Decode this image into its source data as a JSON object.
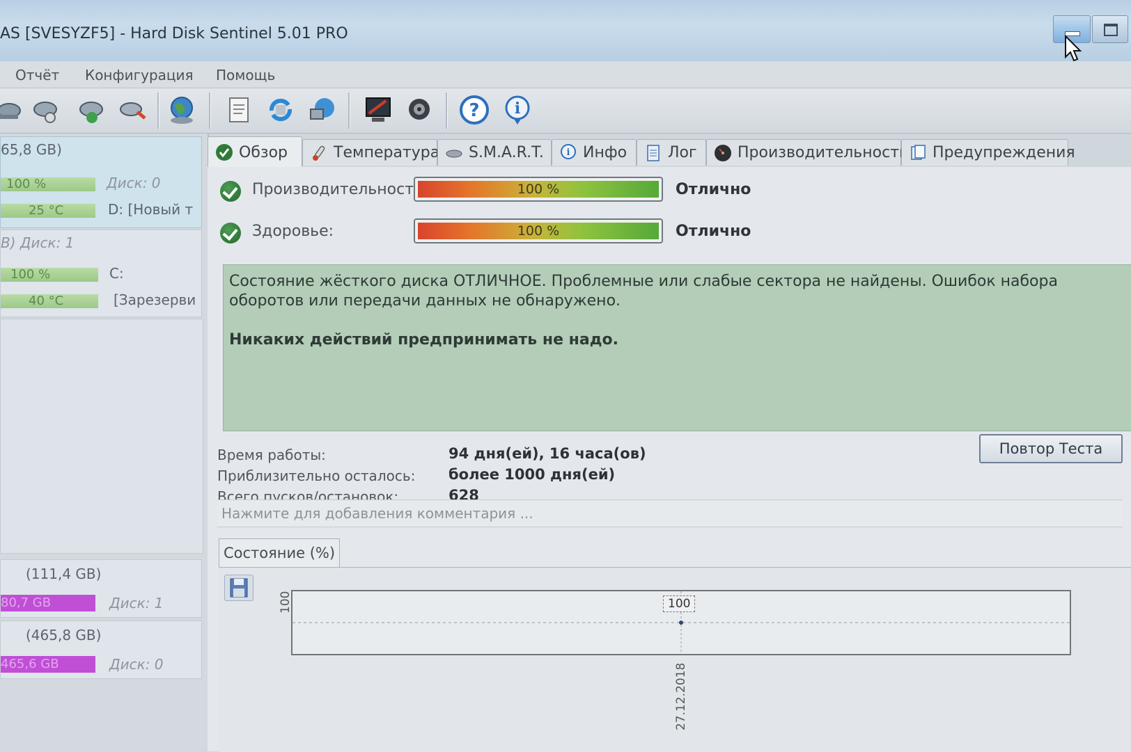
{
  "window": {
    "title": "AS [SVESYZF5]  -  Hard Disk Sentinel 5.01 PRO"
  },
  "menu": {
    "items": [
      "Отчёт",
      "Конфигурация",
      "Помощь"
    ]
  },
  "toolbar": {
    "icons": [
      "disk-icon",
      "disk-check-icon",
      "disk-add-icon",
      "disk-tools-icon",
      "globe-icon",
      "report-icon",
      "refresh-icon",
      "network-icon",
      "monitor-icon",
      "sound-icon",
      "help-icon",
      "info-icon"
    ]
  },
  "left_panel": {
    "disk1": {
      "header": "65,8 GB)",
      "health_bar": "100 %",
      "disk_label": "Диск: 0",
      "temp_bar": "25 °C",
      "volume": "D: [Новый т"
    },
    "disk2": {
      "header": "B)  Диск: 1",
      "health_bar": "100 %",
      "volume1": "C:",
      "temp_bar": "40 °C",
      "volume2": "[Зарезерви"
    },
    "vol1": {
      "size": "(111,4 GB)",
      "free": "80,7 GB",
      "disk_label": "Диск: 1"
    },
    "vol2": {
      "size": "(465,8 GB)",
      "free": "465,6 GB",
      "disk_label": "Диск: 0"
    }
  },
  "tabs": [
    {
      "label": "Обзор",
      "icon": "check-icon"
    },
    {
      "label": "Температура",
      "icon": "thermometer-icon"
    },
    {
      "label": "S.M.A.R.T.",
      "icon": "smart-icon"
    },
    {
      "label": "Инфо",
      "icon": "info-icon"
    },
    {
      "label": "Лог",
      "icon": "log-icon"
    },
    {
      "label": "Производительность",
      "icon": "gauge-icon"
    },
    {
      "label": "Предупреждения",
      "icon": "warnings-icon"
    }
  ],
  "overview": {
    "performance": {
      "label": "Производительность:",
      "percent": "100 %",
      "fraction": 1.0,
      "verdict": "Отлично"
    },
    "health": {
      "label": "Здоровье:",
      "percent": "100 %",
      "fraction": 1.0,
      "verdict": "Отлично"
    },
    "status_text": "Состояние жёсткого диска ОТЛИЧНОЕ. Проблемные или слабые сектора не найдены. Ошибок набора оборотов или передачи данных не обнаружено.",
    "status_action": "Никаких действий предпринимать не надо.",
    "uptime_label": "Время работы:",
    "uptime_value": "94 дня(ей), 16 часа(ов)",
    "remaining_label": "Приблизительно осталось:",
    "remaining_value": "более 1000 дня(ей)",
    "starts_label": "Всего пусков/остановок:",
    "starts_value": "628",
    "retest_button": "Повтор Теста",
    "comment_placeholder": "Нажмите для добавления комментария ...",
    "chart_tab": "Состояние (%)"
  },
  "chart_data": {
    "type": "line",
    "x": [
      "27.12.2018"
    ],
    "series": [
      {
        "values": [
          100
        ]
      }
    ],
    "y_tick": "100",
    "data_label": "100"
  }
}
